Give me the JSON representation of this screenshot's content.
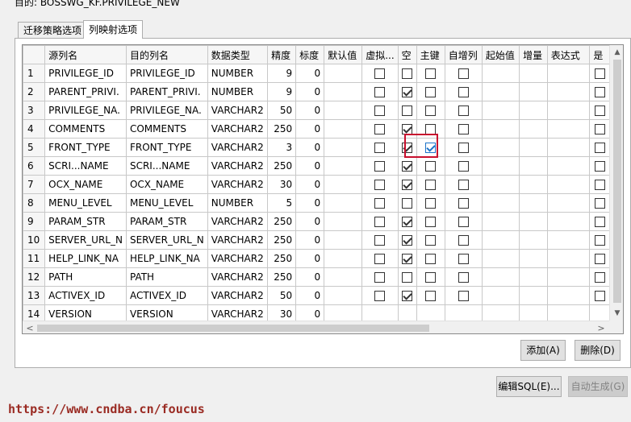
{
  "target": {
    "label": "目的:  BOSSWG_KF.PRIVILEGE_NEW"
  },
  "tabs": [
    {
      "label": "迁移策略选项",
      "active": false
    },
    {
      "label": "列映射选项",
      "active": true
    }
  ],
  "grid": {
    "columns": [
      "源列名",
      "目的列名",
      "数据类型",
      "精度",
      "标度",
      "默认值",
      "虚拟...",
      "空",
      "主键",
      "自增列",
      "起始值",
      "增量",
      "表达式",
      "是"
    ],
    "rows": [
      {
        "n": "1",
        "src": "PRIVILEGE_ID",
        "dst": "PRIVILEGE_ID",
        "type": "NUMBER",
        "precision": "9",
        "scale": "0",
        "virtual": false,
        "nullable": false,
        "pk": false,
        "auto": false,
        "last": false
      },
      {
        "n": "2",
        "src": "PARENT_PRIVI.",
        "dst": "PARENT_PRIVI.",
        "type": "NUMBER",
        "precision": "9",
        "scale": "0",
        "virtual": false,
        "nullable": true,
        "pk": false,
        "auto": false,
        "last": false
      },
      {
        "n": "3",
        "src": "PRIVILEGE_NA.",
        "dst": "PRIVILEGE_NA.",
        "type": "VARCHAR2",
        "precision": "50",
        "scale": "0",
        "virtual": false,
        "nullable": false,
        "pk": false,
        "auto": false,
        "last": false
      },
      {
        "n": "4",
        "src": "COMMENTS",
        "dst": "COMMENTS",
        "type": "VARCHAR2",
        "precision": "250",
        "scale": "0",
        "virtual": false,
        "nullable": true,
        "pk": false,
        "auto": false,
        "last": false
      },
      {
        "n": "5",
        "src": "FRONT_TYPE",
        "dst": "FRONT_TYPE",
        "type": "VARCHAR2",
        "precision": "3",
        "scale": "0",
        "virtual": false,
        "nullable": true,
        "pk": true,
        "auto": false,
        "last": false
      },
      {
        "n": "6",
        "src": "SCRI...NAME",
        "dst": "SCRI...NAME",
        "type": "VARCHAR2",
        "precision": "250",
        "scale": "0",
        "virtual": false,
        "nullable": true,
        "pk": false,
        "auto": false,
        "last": false
      },
      {
        "n": "7",
        "src": "OCX_NAME",
        "dst": "OCX_NAME",
        "type": "VARCHAR2",
        "precision": "30",
        "scale": "0",
        "virtual": false,
        "nullable": true,
        "pk": false,
        "auto": false,
        "last": false
      },
      {
        "n": "8",
        "src": "MENU_LEVEL",
        "dst": "MENU_LEVEL",
        "type": "NUMBER",
        "precision": "5",
        "scale": "0",
        "virtual": false,
        "nullable": false,
        "pk": false,
        "auto": false,
        "last": false
      },
      {
        "n": "9",
        "src": "PARAM_STR",
        "dst": "PARAM_STR",
        "type": "VARCHAR2",
        "precision": "250",
        "scale": "0",
        "virtual": false,
        "nullable": true,
        "pk": false,
        "auto": false,
        "last": false
      },
      {
        "n": "10",
        "src": "SERVER_URL_N",
        "dst": "SERVER_URL_N",
        "type": "VARCHAR2",
        "precision": "250",
        "scale": "0",
        "virtual": false,
        "nullable": true,
        "pk": false,
        "auto": false,
        "last": false
      },
      {
        "n": "11",
        "src": "HELP_LINK_NA",
        "dst": "HELP_LINK_NA",
        "type": "VARCHAR2",
        "precision": "250",
        "scale": "0",
        "virtual": false,
        "nullable": true,
        "pk": false,
        "auto": false,
        "last": false
      },
      {
        "n": "12",
        "src": "PATH",
        "dst": "PATH",
        "type": "VARCHAR2",
        "precision": "250",
        "scale": "0",
        "virtual": false,
        "nullable": false,
        "pk": false,
        "auto": false,
        "last": false
      },
      {
        "n": "13",
        "src": "ACTIVEX_ID",
        "dst": "ACTIVEX_ID",
        "type": "VARCHAR2",
        "precision": "50",
        "scale": "0",
        "virtual": false,
        "nullable": true,
        "pk": false,
        "auto": false,
        "last": false
      },
      {
        "n": "14",
        "src": "VERSION",
        "dst": "VERSION",
        "type": "VARCHAR2",
        "precision": "30",
        "scale": "0",
        "virtual": null,
        "nullable": null,
        "pk": null,
        "auto": null,
        "last": null
      }
    ]
  },
  "scrollbars": {
    "up_icon": "scroll-up-arrow-icon",
    "down_icon": "scroll-down-arrow-icon",
    "left_glyph": "<",
    "right_glyph": ">"
  },
  "buttons": {
    "add": "添加(A)",
    "delete": "删除(D)",
    "edit_sql": "编辑SQL(E)...",
    "auto_generate": "自动生成(G)"
  },
  "watermark": "https://www.cndba.cn/foucus",
  "colors": {
    "highlight": "#c8102e",
    "checkbox_selected": "#1e73c8",
    "watermark": "#9a2b23"
  }
}
